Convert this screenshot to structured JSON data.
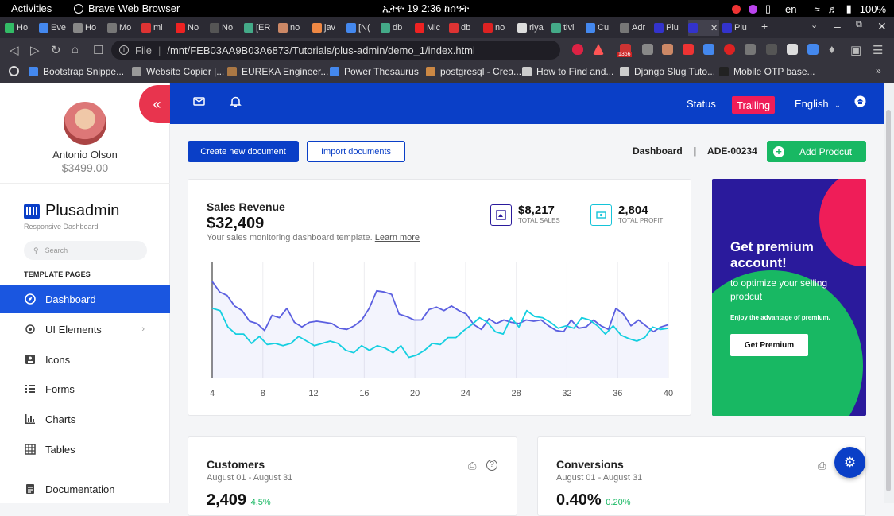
{
  "os": {
    "activities": "Activities",
    "app_name": "Brave Web Browser",
    "clock": "ኢትዮ 19  2:36 ከሰዓት",
    "lang": "en",
    "battery": "100%"
  },
  "browser": {
    "tabs": [
      "Ho",
      "Eve",
      "Ho",
      "Mo",
      "mi",
      "No",
      "No",
      "[ER",
      "no",
      "jav",
      "[N(",
      "db",
      "Mic",
      "db",
      "no",
      "riya",
      "tivi",
      "Cu",
      "Adr",
      "Plu",
      "",
      "Plu"
    ],
    "url": "/mnt/FEB03AA9B03A6873/Tutorials/plus-admin/demo_1/index.html",
    "url_prefix": "File",
    "badge_count": "1366",
    "bookmarks": [
      "Bootstrap Snippe...",
      "Website Copier |...",
      "EUREKA Engineer...",
      "Power Thesaurus",
      "postgresql - Crea...",
      "How to Find and...",
      "Django Slug Tuto...",
      "Mobile OTP base..."
    ]
  },
  "user": {
    "name": "Antonio Olson",
    "balance": "$3499.00"
  },
  "brand": {
    "name": "Plusadmin",
    "tagline": "Responsive Dashboard"
  },
  "search": {
    "placeholder": "Search"
  },
  "sidebar": {
    "section": "TEMPLATE PAGES",
    "items": [
      {
        "label": "Dashboard",
        "icon": "compass-icon"
      },
      {
        "label": "UI Elements",
        "icon": "crosshair-icon"
      },
      {
        "label": "Icons",
        "icon": "contact-card-icon"
      },
      {
        "label": "Forms",
        "icon": "list-icon"
      },
      {
        "label": "Charts",
        "icon": "bar-chart-icon"
      },
      {
        "label": "Tables",
        "icon": "grid-icon"
      },
      {
        "label": "Documentation",
        "icon": "document-icon"
      }
    ]
  },
  "header": {
    "status": "Status",
    "trailing": "Trailing",
    "language": "English"
  },
  "actions": {
    "create": "Create new document",
    "import": "Import documents",
    "crumb_page": "Dashboard",
    "crumb_sep": "|",
    "crumb_id": "ADE-00234",
    "add": "Add Prodcut"
  },
  "revenue": {
    "title": "Sales Revenue",
    "value": "$32,409",
    "desc": "Your sales monitoring dashboard template.",
    "link": "Learn more",
    "stats": [
      {
        "value": "$8,217",
        "label": "TOTAL SALES",
        "color": "#2a1a9c"
      },
      {
        "value": "2,804",
        "label": "TOTAL PROFIT",
        "color": "#14c4d9"
      }
    ]
  },
  "chart_data": {
    "type": "area",
    "x": [
      1,
      2,
      3,
      4,
      5,
      6,
      7,
      8,
      9,
      10,
      11,
      12,
      13,
      14,
      15,
      16,
      17,
      18,
      19,
      20,
      21,
      22,
      23,
      24,
      25,
      26,
      27,
      28,
      29,
      30,
      31,
      32,
      33,
      34,
      35,
      36,
      37,
      38,
      39,
      40
    ],
    "xticks": [
      4,
      8,
      12,
      16,
      20,
      24,
      28,
      32,
      36,
      40
    ],
    "xlim": [
      4,
      40
    ],
    "ylim": [
      0,
      100
    ],
    "grid": true,
    "series": [
      {
        "color": "#5b5fe0",
        "values": [
          83,
          74,
          71,
          62,
          58,
          49,
          47,
          41,
          54,
          52,
          60,
          48,
          44,
          48,
          49,
          48,
          47,
          43,
          42,
          45,
          50,
          60,
          75,
          74,
          72,
          55,
          53,
          50,
          50,
          59,
          61,
          58,
          62,
          58,
          55,
          46,
          42,
          51,
          47,
          50,
          48,
          47,
          50,
          49,
          50,
          45,
          41,
          40,
          50,
          43,
          44,
          50,
          45,
          42,
          60,
          55,
          45,
          50,
          45,
          40,
          44,
          46
        ]
      },
      {
        "color": "#14cfe0",
        "values": [
          60,
          58,
          44,
          38,
          38,
          30,
          36,
          29,
          30,
          28,
          30,
          36,
          32,
          28,
          30,
          32,
          30,
          24,
          22,
          28,
          24,
          28,
          26,
          22,
          28,
          18,
          20,
          24,
          30,
          29,
          35,
          35,
          41,
          46,
          52,
          48,
          40,
          38,
          52,
          44,
          58,
          53,
          52,
          48,
          43,
          45,
          43,
          52,
          50,
          45,
          38,
          45,
          37,
          34,
          32,
          35,
          44,
          42,
          43
        ]
      }
    ]
  },
  "promo": {
    "title": "Get premium account!",
    "desc": "to optimize your selling prodcut",
    "small": "Enjoy the advantage of premium.",
    "button": "Get Premium",
    "colors": {
      "bg": "#2a1a9c",
      "pink": "#ef1d58",
      "green": "#18b863"
    }
  },
  "customers": {
    "title": "Customers",
    "period": "August 01 - August 31",
    "value": "2,409",
    "delta": "4.5%"
  },
  "conversions": {
    "title": "Conversions",
    "period": "August 01 - August 31",
    "value": "0.40%",
    "delta": "0.20%"
  },
  "colors": {
    "primary": "#0a3fc7",
    "accent": "#ef1d58",
    "success": "#18b863"
  }
}
